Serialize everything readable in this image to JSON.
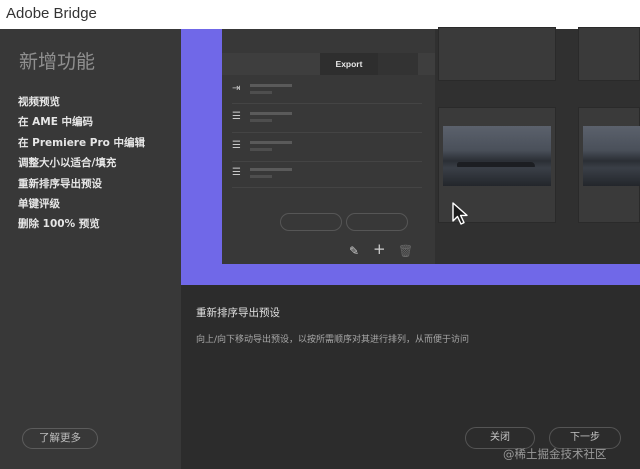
{
  "window": {
    "title": "Adobe Bridge"
  },
  "sidebar": {
    "heading": "新增功能",
    "features": [
      "视频预览",
      "在 AME 中编码",
      "在 Premiere Pro 中编辑",
      "调整大小以适合/填充",
      "重新排序导出预设",
      "单键评级",
      "删除 100% 预览"
    ],
    "learn_more_label": "了解更多"
  },
  "preview": {
    "export_tab_label": "Export",
    "toolbar_icons": [
      "pencil-icon",
      "plus-icon",
      "trash-icon"
    ],
    "accent_color": "#7068e8"
  },
  "description": {
    "title": "重新排序导出预设",
    "body": "向上/向下移动导出预设，以按所需顺序对其进行排列，从而便于访问"
  },
  "footer": {
    "close_label": "关闭",
    "next_label": "下一步"
  },
  "watermark": "@稀土掘金技术社区"
}
